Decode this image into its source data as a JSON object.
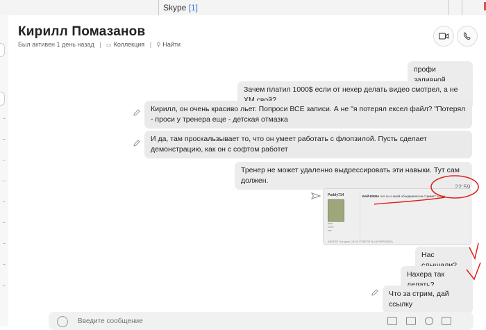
{
  "window": {
    "title": "Skype",
    "title_count": "[1]"
  },
  "header": {
    "contact_name": "Кирилл Помазанов",
    "last_active": "Был активен 1 день назад",
    "collection": "Коллекция",
    "find": "Найти"
  },
  "messages": [
    {
      "text": "профи заливной",
      "direction": "out"
    },
    {
      "text": "Зачем платил 1000$ если от нехер делать видео смотрел, а не ХМ свой?",
      "direction": "out"
    },
    {
      "text": "Кирилл, он очень красиво льет. Попроси ВСЕ записи. А не \"я потерял ексел файл? \"Потерял - проси у тренера еще - детская отмазка",
      "direction": "in"
    },
    {
      "text": "И да, там проскальзывает то, что он умеет работать с флопзилой. Пусть сделает демонстрацию, как он с софтом работет",
      "direction": "in"
    },
    {
      "text": "Тренер не может удаленно выдрессировать эти навыки. Тут сам должен.",
      "direction": "out"
    },
    {
      "text": "Нас слышали?",
      "direction": "out"
    },
    {
      "text": "Нахера так делать?",
      "direction": "out"
    },
    {
      "text": "Что за стрим, дай ссылку",
      "direction": "out"
    }
  ],
  "timestamp": "22:59",
  "attachment": {
    "username": "Paddy714",
    "message_author": "БАЙ-DEMA",
    "message_text": "это ты о моей обьединили на стриме? отлож",
    "footer": "АВАТАР  Сегодня, 19:33   ОТВЕТИТЬ   ЦИТИРОВАТЬ"
  },
  "compose": {
    "placeholder": "Введите сообщение"
  },
  "colors": {
    "annotation_red": "#e0201c",
    "accent_blue": "#3a78d4",
    "bubble": "#ebebeb"
  }
}
